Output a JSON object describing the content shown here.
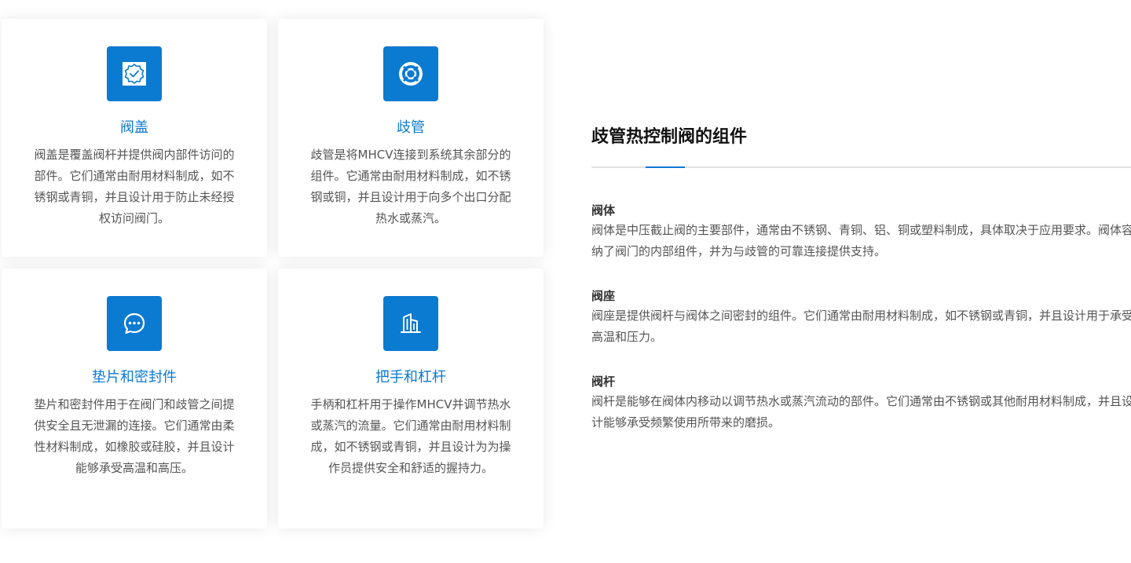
{
  "cards": [
    {
      "icon": "badge-check-icon",
      "title": "阀盖",
      "desc": "阀盖是覆盖阀杆并提供阀内部件访问的部件。它们通常由耐用材料制成，如不锈钢或青铜，并且设计用于防止未经授权访问阀门。"
    },
    {
      "icon": "lifebuoy-icon",
      "title": "歧管",
      "desc": "歧管是将MHCV连接到系统其余部分的组件。它通常由耐用材料制成，如不锈钢或铜，并且设计用于向多个出口分配热水或蒸汽。"
    },
    {
      "icon": "chat-bubble-icon",
      "title": "垫片和密封件",
      "desc": "垫片和密封件用于在阀门和歧管之间提供安全且无泄漏的连接。它们通常由柔性材料制成，如橡胶或硅胶，并且设计能够承受高温和高压。"
    },
    {
      "icon": "building-icon",
      "title": "把手和杠杆",
      "desc": "手柄和杠杆用于操作MHCV并调节热水或蒸汽的流量。它们通常由耐用材料制成，如不锈钢或青铜，并且设计为为操作员提供安全和舒适的握持力。"
    }
  ],
  "section": {
    "title": "歧管热控制阀的组件",
    "items": [
      {
        "title": "阀体",
        "text": "阀体是中压截止阀的主要部件，通常由不锈钢、青铜、铝、铜或塑料制成，具体取决于应用要求。阀体容纳了阀门的内部组件，并为与歧管的可靠连接提供支持。"
      },
      {
        "title": "阀座",
        "text": "阀座是提供阀杆与阀体之间密封的组件。它们通常由耐用材料制成，如不锈钢或青铜，并且设计用于承受高温和压力。"
      },
      {
        "title": "阀杆",
        "text": "阀杆是能够在阀体内移动以调节热水或蒸汽流动的部件。它们通常由不锈钢或其他耐用材料制成，并且设计能够承受频繁使用所带来的磨损。"
      }
    ]
  },
  "colors": {
    "accent": "#0b7ad1",
    "title_text": "#111111",
    "body_text": "#555555"
  }
}
